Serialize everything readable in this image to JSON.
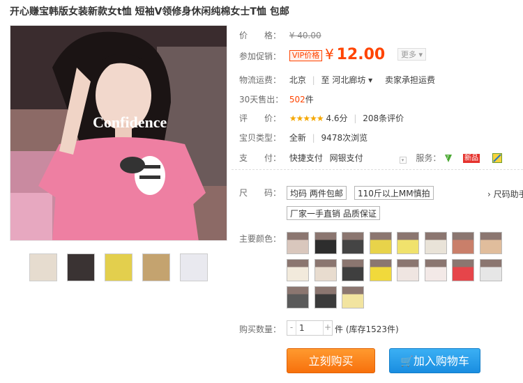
{
  "title": "开心赚宝韩版女装新款女t恤 短袖V领修身休闲纯棉女士T恤 包邮",
  "price": {
    "label": "价　　格：",
    "original": "¥ 40.00"
  },
  "promo": {
    "label": "参加促销：",
    "vip_badge": "VIP价格",
    "yen": "¥",
    "amount": "12.00",
    "more": "更多 ▾"
  },
  "shipping": {
    "label": "物流运费：",
    "from": "北京",
    "to": "至  河北廊坊 ▾",
    "note": "卖家承担运费"
  },
  "sales": {
    "label": "30天售出：",
    "count": "502",
    "unit": "件"
  },
  "rating": {
    "label": "评　　价：",
    "stars": "★★★★★",
    "score": "4.6分",
    "reviews": "208条评价"
  },
  "item_type": {
    "label": "宝贝类型：",
    "value": "全新",
    "views": "9478次浏览"
  },
  "payment": {
    "label": "支　　付：",
    "options": [
      "快捷支付",
      "网银支付"
    ],
    "service_label": "服务：",
    "new_badge": "新品"
  },
  "size": {
    "label": "尺　　码：",
    "options": [
      "均码 两件包邮",
      "110斤以上MM慎拍",
      "厂家一手直销 品质保证"
    ],
    "helper": "› 尺码助手"
  },
  "colors": {
    "label": "主要颜色：",
    "count": 19,
    "tones": [
      "#d9c7bd",
      "#2d2d2d",
      "#444",
      "#e8d34a",
      "#f0e26c",
      "#e9e3d8",
      "#c97f6a",
      "#e0bd9c",
      "#f2eadc",
      "#e8dccf",
      "#3f3f3f",
      "#f1d93b",
      "#efe5e1",
      "#f3e9e7",
      "#e6454a",
      "#e6e6e6",
      "#5a5a5a",
      "#3b3b3b",
      "#f2e4a0"
    ]
  },
  "quantity": {
    "label": "购买数量：",
    "value": "1",
    "stock": "件 (库存1523件)"
  },
  "buttons": {
    "buy": "立刻购买",
    "cart": "加入购物车"
  },
  "main_image": {
    "shirt_text": "Confidence"
  }
}
